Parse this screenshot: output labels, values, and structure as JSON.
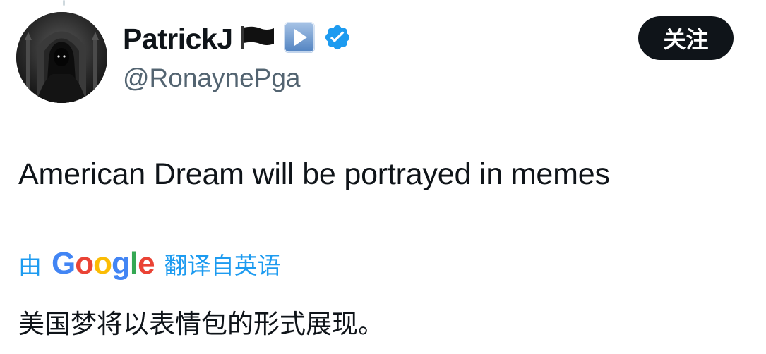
{
  "author": {
    "display_name": "PatrickJ",
    "handle": "@RonaynePga",
    "badges": [
      "black-flag-icon",
      "play-button-icon",
      "verified-badge-icon"
    ]
  },
  "follow_button": {
    "label": "关注"
  },
  "tweet": {
    "text": "American Dream will be portrayed in memes"
  },
  "translation": {
    "prefix": "由",
    "provider_logo_letters": [
      "G",
      "o",
      "o",
      "g",
      "l",
      "e"
    ],
    "suffix": "翻译自英语",
    "translated_text": "美国梦将以表情包的形式展现。"
  },
  "colors": {
    "text_primary": "#0f1419",
    "text_secondary": "#536471",
    "link_blue": "#1d9bf0",
    "verified_blue": "#1d9bf0",
    "button_bg": "#0f1419",
    "google_blue": "#4285f4",
    "google_red": "#ea4335",
    "google_yellow": "#fbbc05",
    "google_green": "#34a853"
  }
}
